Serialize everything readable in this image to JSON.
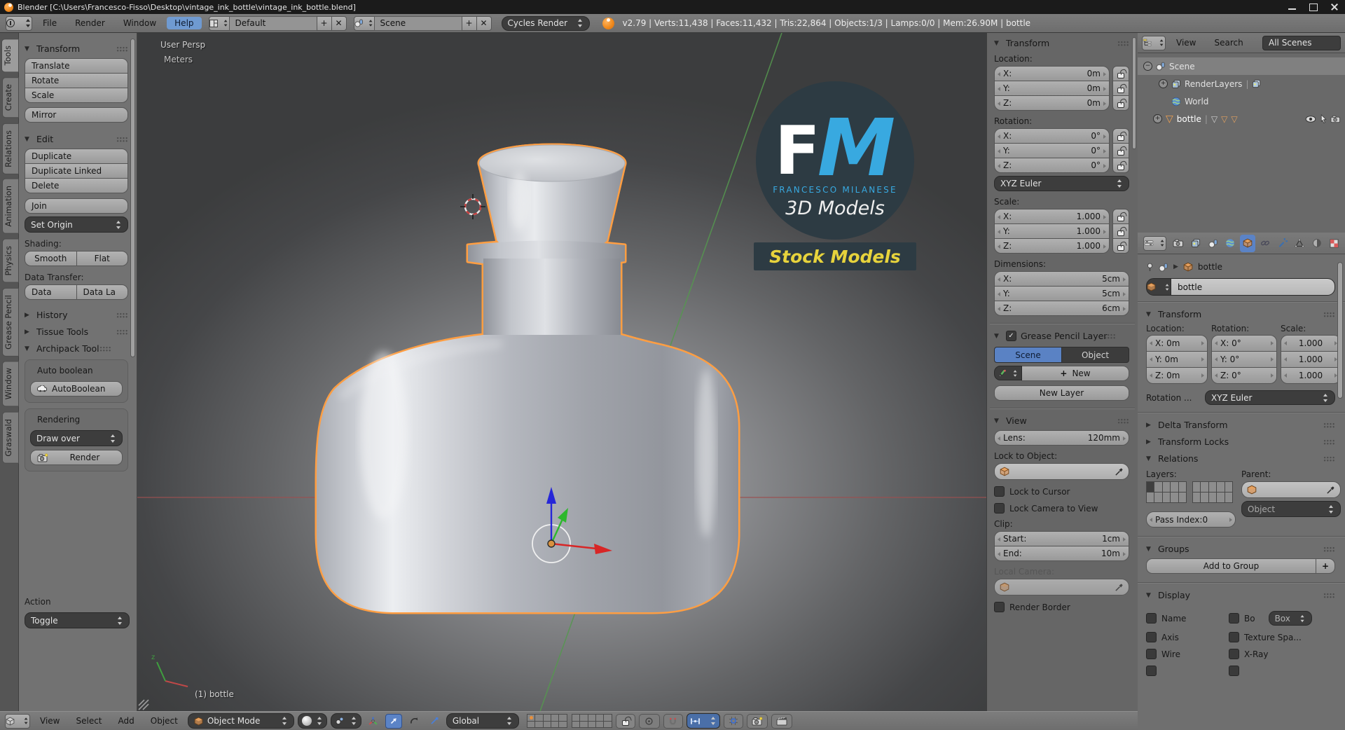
{
  "window": {
    "title": "Blender [C:\\Users\\Francesco-Fisso\\Desktop\\vintage_ink_bottle\\vintage_ink_bottle.blend]"
  },
  "icons": {
    "expanded": "▼",
    "collapsed": "▶",
    "check": "✓",
    "plus": "+",
    "close": "✕",
    "minus": "−",
    "tri_down": "▽",
    "pipe": "|",
    "crumb_arrow": "▶"
  },
  "topbar": {
    "menus": [
      "File",
      "Render",
      "Window",
      "Help"
    ],
    "layout": "Default",
    "scene": "Scene",
    "engine": "Cycles Render",
    "stats": "v2.79 | Verts:11,438 | Faces:11,432 | Tris:22,864 | Objects:1/3 | Lamps:0/0 | Mem:26.90M | bottle"
  },
  "tool_tabs": [
    "Tools",
    "Create",
    "Relations",
    "Animation",
    "Physics",
    "Grease Pencil",
    "Window",
    "Graswald"
  ],
  "tools": {
    "transform_title": "Transform",
    "translate": "Translate",
    "rotate": "Rotate",
    "scale": "Scale",
    "mirror": "Mirror",
    "edit_title": "Edit",
    "duplicate": "Duplicate",
    "duplicate_linked": "Duplicate Linked",
    "delete": "Delete",
    "join": "Join",
    "set_origin": "Set Origin",
    "shading_label": "Shading:",
    "smooth": "Smooth",
    "flat": "Flat",
    "data_transfer_label": "Data Transfer:",
    "data": "Data",
    "data_layout": "Data La",
    "history_title": "History",
    "tissue_title": "Tissue Tools",
    "archipack_title": "Archipack Tool",
    "auto_boolean_label": "Auto boolean",
    "autoboolean": "AutoBoolean",
    "rendering_label": "Rendering",
    "draw_over": "Draw over",
    "render": "Render",
    "redo_label": "Action",
    "redo_value": "Toggle"
  },
  "viewport": {
    "view_label": "User Persp",
    "unit_label": "Meters",
    "object_label": "(1) bottle",
    "logo": {
      "f": "F",
      "m": "M",
      "name": "FRANCESCO MILANESE",
      "tagline": "3D Models",
      "banner": "Stock Models"
    }
  },
  "npanel": {
    "transform_title": "Transform",
    "location_label": "Location:",
    "loc": [
      {
        "k": "X:",
        "v": "0m"
      },
      {
        "k": "Y:",
        "v": "0m"
      },
      {
        "k": "Z:",
        "v": "0m"
      }
    ],
    "rotation_label": "Rotation:",
    "rot": [
      {
        "k": "X:",
        "v": "0°"
      },
      {
        "k": "Y:",
        "v": "0°"
      },
      {
        "k": "Z:",
        "v": "0°"
      }
    ],
    "rotation_mode": "XYZ Euler",
    "scale_label": "Scale:",
    "scl": [
      {
        "k": "X:",
        "v": "1.000"
      },
      {
        "k": "Y:",
        "v": "1.000"
      },
      {
        "k": "Z:",
        "v": "1.000"
      }
    ],
    "dimensions_label": "Dimensions:",
    "dim": [
      {
        "k": "X:",
        "v": "5cm"
      },
      {
        "k": "Y:",
        "v": "5cm"
      },
      {
        "k": "Z:",
        "v": "6cm"
      }
    ],
    "gp_title": "Grease Pencil Layer",
    "gp_scene": "Scene",
    "gp_object": "Object",
    "gp_new": "New",
    "gp_new_layer": "New Layer",
    "view_title": "View",
    "lens_label": "Lens:",
    "lens_value": "120mm",
    "lock_object_label": "Lock to Object:",
    "lock_cursor": "Lock to Cursor",
    "lock_camera": "Lock Camera to View",
    "clip_label": "Clip:",
    "clip_start_label": "Start:",
    "clip_start_value": "1cm",
    "clip_end_label": "End:",
    "clip_end_value": "10m",
    "local_camera_label": "Local Camera:",
    "render_border": "Render Border"
  },
  "outliner": {
    "menu_view": "View",
    "menu_search": "Search",
    "filter": "All Scenes",
    "scene": "Scene",
    "renderlayers": "RenderLayers",
    "world": "World",
    "object": "bottle"
  },
  "props": {
    "breadcrumb_object": "bottle",
    "name_value": "bottle",
    "transform_title": "Transform",
    "location_label": "Location:",
    "rotation_label": "Rotation:",
    "scale_label": "Scale:",
    "loc": [
      "X: 0m",
      "Y: 0m",
      "Z: 0m"
    ],
    "rot": [
      "X: 0°",
      "Y: 0°",
      "Z: 0°"
    ],
    "scl": [
      "1.000",
      "1.000",
      "1.000"
    ],
    "rotation_mode_label": "Rotation ...",
    "rotation_mode": "XYZ Euler",
    "delta_title": "Delta Transform",
    "locks_title": "Transform Locks",
    "relations_title": "Relations",
    "layers_label": "Layers:",
    "parent_label": "Parent:",
    "object_dropdown": "Object",
    "pass_index": "Pass Index:0",
    "groups_title": "Groups",
    "add_to_group": "Add to Group",
    "display_title": "Display",
    "chk_name": "Name",
    "chk_axis": "Axis",
    "chk_wire": "Wire",
    "chk_bounds": "Bo",
    "bounds_type": "Box",
    "chk_texspace": "Texture Spa...",
    "chk_xray": "X-Ray"
  },
  "footer": {
    "menus": [
      "View",
      "Select",
      "Add",
      "Object"
    ],
    "mode": "Object Mode",
    "orientation": "Global"
  }
}
